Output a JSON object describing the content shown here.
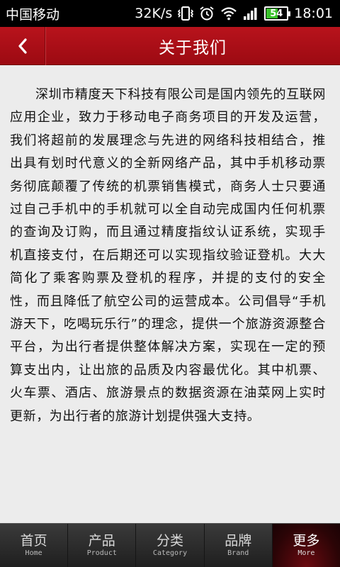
{
  "status_bar": {
    "carrier": "中国移动",
    "speed": "32K/s",
    "battery": "54",
    "time": "18:01"
  },
  "header": {
    "back_symbol": "‹",
    "title": "关于我们"
  },
  "content": {
    "body": "深圳市精度天下科技有限公司是国内领先的互联网应用企业，致力于移动电子商务项目的开发及运营，我们将超前的发展理念与先进的网络科技相结合，推出具有划时代意义的全新网络产品，其中手机移动票务彻底颠覆了传统的机票销售模式，商务人士只要通过自己手机中的手机就可以全自动完成国内任何机票的查询及订购，而且通过精度指纹认证系统，实现手机直接支付，在后期还可以实现指纹验证登机。大大简化了乘客购票及登机的程序，并提的支付的安全性，而且降低了航空公司的运营成本。公司倡导“手机游天下，吃喝玩乐行”的理念，提供一个旅游资源整合平台，为出行者提供整体解决方案，实现在一定的预算支出内，让出旅的品质及内容最优化。其中机票、火车票、酒店、旅游景点的数据资源在油菜网上实时更新，为出行者的旅游计划提供强大支持。"
  },
  "tabs": [
    {
      "label": "首页",
      "sublabel": "Home"
    },
    {
      "label": "产品",
      "sublabel": "Product"
    },
    {
      "label": "分类",
      "sublabel": "Category"
    },
    {
      "label": "品牌",
      "sublabel": "Brand"
    },
    {
      "label": "更多",
      "sublabel": "More"
    }
  ],
  "active_tab": 4,
  "colors": {
    "header_red": "#b8131c",
    "battery_green": "#39c12b"
  }
}
